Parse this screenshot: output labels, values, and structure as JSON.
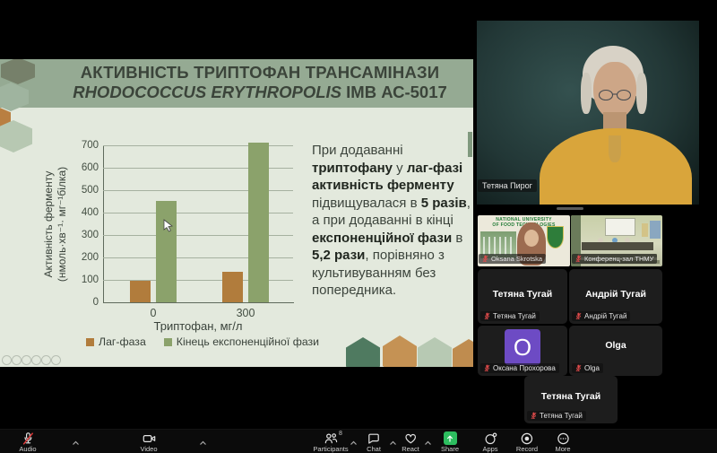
{
  "slide": {
    "title_line1": "АКТИВНІСТЬ ТРИПТОФАН ТРАНСАМІНАЗИ",
    "title_line2_italic": "RHODOCOCCUS ERYTHROPOLIS",
    "title_line2_plain": " ІМВ АС-5017",
    "paragraph": [
      {
        "text": "При додаванні ",
        "bold": false
      },
      {
        "text": "триптофану",
        "bold": true
      },
      {
        "text": " у ",
        "bold": false
      },
      {
        "text": "лаг-фазі",
        "bold": true
      },
      {
        "text": " ",
        "bold": false
      },
      {
        "text": "активність ферменту",
        "bold": true
      },
      {
        "text": " підвищувалася в ",
        "bold": false
      },
      {
        "text": "5 разів",
        "bold": true
      },
      {
        "text": ", а при додаванні в кінці ",
        "bold": false
      },
      {
        "text": "експоненційної фази",
        "bold": true
      },
      {
        "text": " в ",
        "bold": false
      },
      {
        "text": "5,2 рази",
        "bold": true
      },
      {
        "text": ", порівняно з культивуванням без попередника.",
        "bold": false
      }
    ],
    "chart_data": {
      "type": "bar",
      "categories": [
        "0",
        "300"
      ],
      "series": [
        {
          "name": "Лаг-фаза",
          "color": "#b17c3c",
          "values": [
            95,
            135
          ]
        },
        {
          "name": "Кінець експоненційної фази",
          "color": "#8ba26b",
          "values": [
            450,
            710
          ]
        }
      ],
      "xlabel": "Триптофан, мг/л",
      "ylabel_line1": "Активність ферменту",
      "ylabel_line2": "(нмоль·хв⁻¹· мг⁻¹білка)",
      "ylim": [
        0,
        700
      ],
      "ytick_step": 100,
      "grid": true,
      "legend_position": "bottom"
    }
  },
  "video_panel": {
    "speaker": {
      "name": "Тетяна Пирог"
    },
    "thumbnails": [
      {
        "name": "Oksana Skrotska",
        "muted": true,
        "banner_line1": "NATIONAL UNIVERSITY",
        "banner_line2": "OF FOOD TECHNOLOGIES"
      },
      {
        "name": "Конференц-зал ТНМУ",
        "muted": true
      }
    ],
    "tiles": [
      {
        "display": "Тетяна Тугай",
        "tag": "Тетяна Тугай",
        "muted": true,
        "kind": "name"
      },
      {
        "display": "Андрій Тугай",
        "tag": "Андрій Тугай",
        "muted": true,
        "kind": "name"
      },
      {
        "display": "O",
        "tag": "Оксана Прохорова",
        "muted": true,
        "kind": "avatar",
        "avatar_color": "#6d4bc4"
      },
      {
        "display": "Olga",
        "tag": "Olga",
        "muted": true,
        "kind": "name"
      },
      {
        "display": "Тетяна Тугай",
        "tag": "Тетяна Тугай",
        "muted": true,
        "kind": "name"
      }
    ]
  },
  "toolbar": {
    "share_accent": "#2dbd5f",
    "muted_red": "#e03a3a",
    "buttons": [
      {
        "id": "audio",
        "label": "Audio",
        "icon": "mic-muted-icon",
        "caret": true
      },
      {
        "id": "video",
        "label": "Video",
        "icon": "camera-icon",
        "caret": true
      },
      {
        "id": "participants",
        "label": "Participants",
        "icon": "participants-icon",
        "badge": "8",
        "caret": true
      },
      {
        "id": "chat",
        "label": "Chat",
        "icon": "chat-icon",
        "caret": true
      },
      {
        "id": "react",
        "label": "React",
        "icon": "heart-icon",
        "caret": true
      },
      {
        "id": "share",
        "label": "Share",
        "icon": "share-icon"
      },
      {
        "id": "apps",
        "label": "Apps",
        "icon": "apps-icon"
      },
      {
        "id": "record",
        "label": "Record",
        "icon": "record-icon"
      },
      {
        "id": "more",
        "label": "More",
        "icon": "more-icon"
      }
    ]
  }
}
